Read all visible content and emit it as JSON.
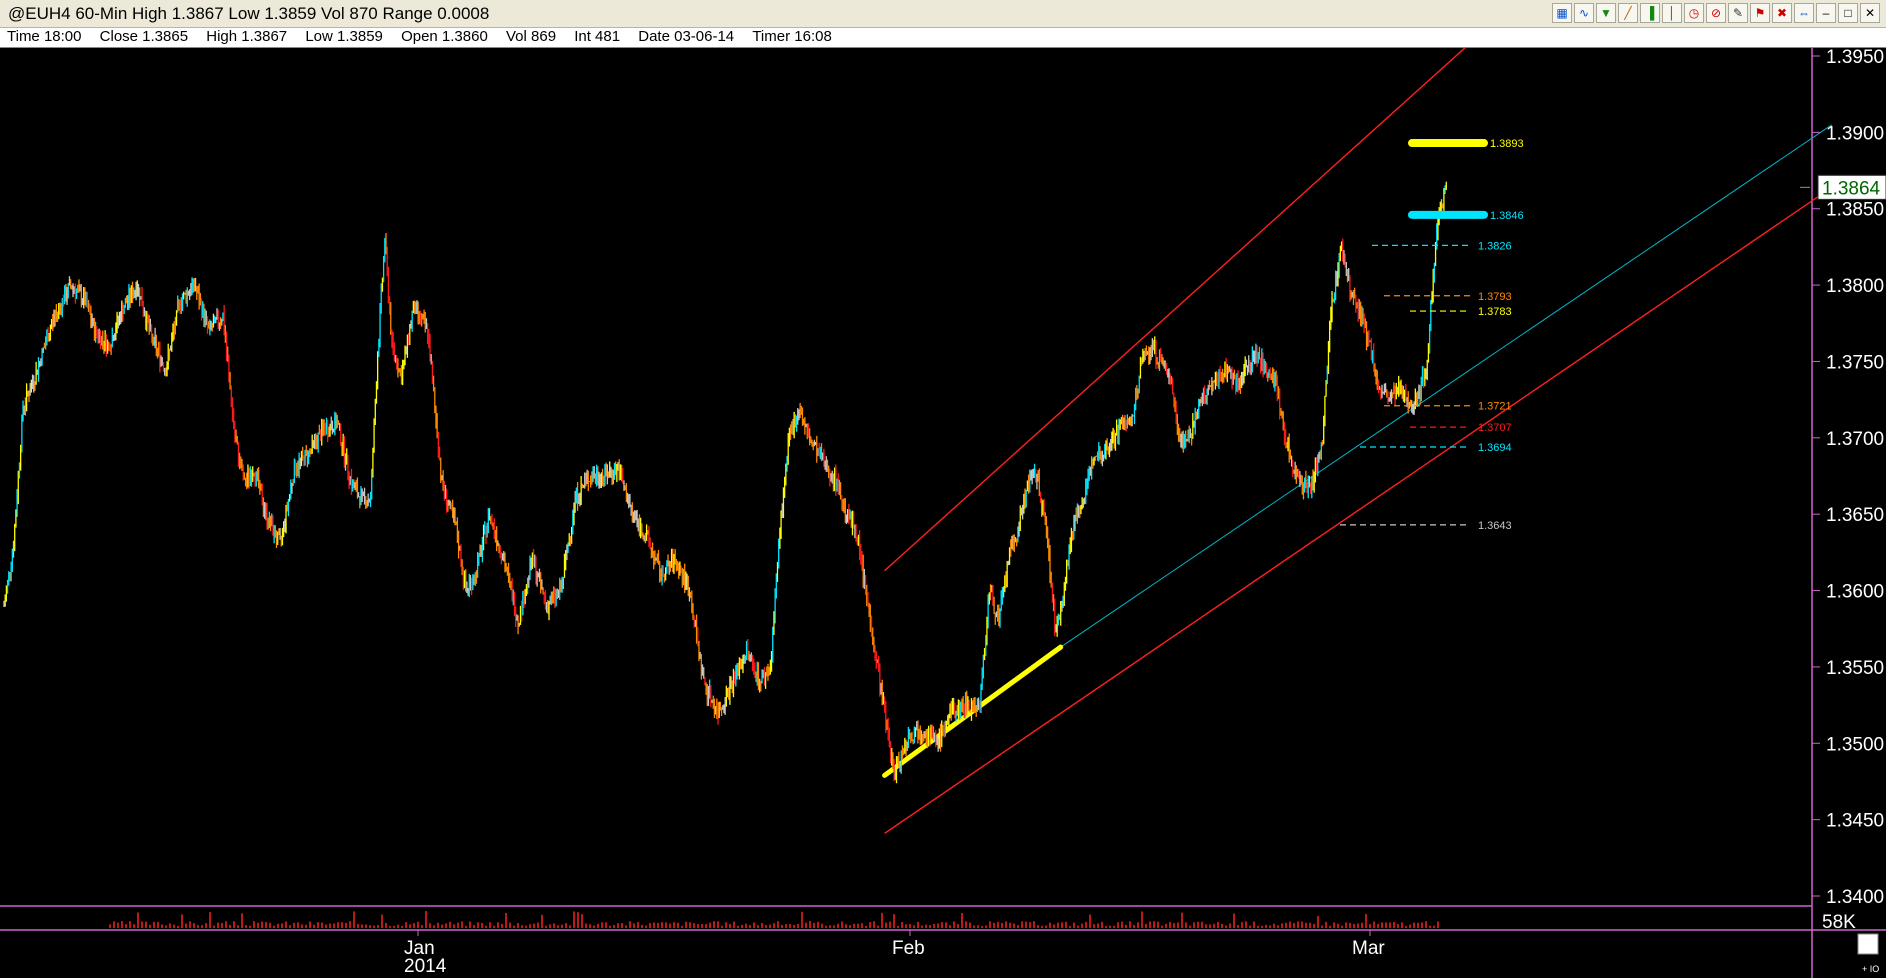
{
  "title": "@EUH4 60-Min High 1.3867 Low 1.3859 Vol 870 Range 0.0008",
  "toolbar_icons": [
    "chart-type-icon",
    "wave-icon",
    "filter-icon",
    "line-draw-icon",
    "bar-chart-icon",
    "candle-icon",
    "clock-icon",
    "no-entry-icon",
    "pencil-icon",
    "flag-icon",
    "delete-icon",
    "scroll-icon",
    "minimize-icon",
    "restore-icon",
    "close-icon"
  ],
  "info": {
    "time": "Time 18:00",
    "close": "Close 1.3865",
    "high": "High 1.3867",
    "low": "Low 1.3859",
    "open": "Open 1.3860",
    "vol": "Vol 869",
    "int": "Int 481",
    "date": "Date 03-06-14",
    "timer": "Timer 16:08"
  },
  "colors": {
    "background": "#000000",
    "axis": "#cc66cc",
    "channel": "#ff2020",
    "midline": "#00b8c8",
    "yellow": "#ffff00",
    "cyan": "#00e5ff",
    "orange": "#ff8a00",
    "red": "#ff1a1a",
    "white": "#c8c8c8",
    "price_label_bg": "#ffffff",
    "price_label_fg": "#006600"
  },
  "chart_data": {
    "type": "line",
    "symbol": "@EUH4",
    "interval": "60-Min",
    "y_axis": {
      "ticks": [
        "1.3950",
        "1.3900",
        "1.3850",
        "1.3800",
        "1.3750",
        "1.3700",
        "1.3650",
        "1.3600",
        "1.3550",
        "1.3500",
        "1.3450",
        "1.3400"
      ],
      "min": 1.34,
      "max": 1.395
    },
    "x_axis": {
      "labels": [
        "Jan",
        "2014",
        "Feb",
        "Mar"
      ]
    },
    "current_price": "1.3864",
    "volume_label": "58K",
    "price_path": [
      [
        0,
        1.359
      ],
      [
        4,
        1.363
      ],
      [
        8,
        1.372
      ],
      [
        14,
        1.3745
      ],
      [
        20,
        1.3775
      ],
      [
        28,
        1.38
      ],
      [
        34,
        1.379
      ],
      [
        38,
        1.377
      ],
      [
        44,
        1.376
      ],
      [
        50,
        1.3785
      ],
      [
        56,
        1.38
      ],
      [
        62,
        1.3765
      ],
      [
        68,
        1.3745
      ],
      [
        74,
        1.379
      ],
      [
        80,
        1.38
      ],
      [
        86,
        1.377
      ],
      [
        92,
        1.378
      ],
      [
        97,
        1.37
      ],
      [
        101,
        1.367
      ],
      [
        105,
        1.368
      ],
      [
        110,
        1.365
      ],
      [
        116,
        1.363
      ],
      [
        122,
        1.368
      ],
      [
        128,
        1.369
      ],
      [
        134,
        1.3705
      ],
      [
        140,
        1.371
      ],
      [
        146,
        1.367
      ],
      [
        150,
        1.366
      ],
      [
        154,
        1.366
      ],
      [
        157,
        1.3755
      ],
      [
        160,
        1.383
      ],
      [
        163,
        1.376
      ],
      [
        167,
        1.374
      ],
      [
        172,
        1.3785
      ],
      [
        178,
        1.377
      ],
      [
        184,
        1.367
      ],
      [
        190,
        1.364
      ],
      [
        194,
        1.36
      ],
      [
        198,
        1.361
      ],
      [
        204,
        1.365
      ],
      [
        210,
        1.362
      ],
      [
        216,
        1.358
      ],
      [
        222,
        1.362
      ],
      [
        228,
        1.359
      ],
      [
        234,
        1.36
      ],
      [
        240,
        1.366
      ],
      [
        246,
        1.3675
      ],
      [
        252,
        1.3675
      ],
      [
        258,
        1.368
      ],
      [
        264,
        1.365
      ],
      [
        270,
        1.3635
      ],
      [
        276,
        1.361
      ],
      [
        282,
        1.362
      ],
      [
        288,
        1.36
      ],
      [
        294,
        1.354
      ],
      [
        300,
        1.352
      ],
      [
        306,
        1.354
      ],
      [
        312,
        1.356
      ],
      [
        318,
        1.354
      ],
      [
        322,
        1.355
      ],
      [
        326,
        1.364
      ],
      [
        330,
        1.37
      ],
      [
        334,
        1.372
      ],
      [
        338,
        1.37
      ],
      [
        342,
        1.369
      ],
      [
        346,
        1.368
      ],
      [
        350,
        1.367
      ],
      [
        354,
        1.365
      ],
      [
        358,
        1.364
      ],
      [
        362,
        1.36
      ],
      [
        366,
        1.356
      ],
      [
        370,
        1.352
      ],
      [
        374,
        1.348
      ],
      [
        380,
        1.3505
      ],
      [
        386,
        1.351
      ],
      [
        392,
        1.35
      ],
      [
        398,
        1.352
      ],
      [
        404,
        1.3525
      ],
      [
        410,
        1.3525
      ],
      [
        414,
        1.36
      ],
      [
        418,
        1.358
      ],
      [
        422,
        1.362
      ],
      [
        426,
        1.364
      ],
      [
        430,
        1.367
      ],
      [
        434,
        1.3675
      ],
      [
        438,
        1.364
      ],
      [
        442,
        1.357
      ],
      [
        446,
        1.361
      ],
      [
        450,
        1.365
      ],
      [
        454,
        1.366
      ],
      [
        458,
        1.369
      ],
      [
        462,
        1.369
      ],
      [
        466,
        1.37
      ],
      [
        470,
        1.371
      ],
      [
        474,
        1.371
      ],
      [
        478,
        1.375
      ],
      [
        482,
        1.376
      ],
      [
        486,
        1.375
      ],
      [
        490,
        1.374
      ],
      [
        494,
        1.37
      ],
      [
        498,
        1.37
      ],
      [
        502,
        1.372
      ],
      [
        506,
        1.373
      ],
      [
        510,
        1.374
      ],
      [
        514,
        1.3745
      ],
      [
        518,
        1.3735
      ],
      [
        522,
        1.3745
      ],
      [
        526,
        1.3755
      ],
      [
        530,
        1.3745
      ],
      [
        534,
        1.374
      ],
      [
        538,
        1.37
      ],
      [
        542,
        1.368
      ],
      [
        546,
        1.367
      ],
      [
        550,
        1.367
      ],
      [
        554,
        1.37
      ],
      [
        558,
        1.379
      ],
      [
        562,
        1.3825
      ],
      [
        566,
        1.3795
      ],
      [
        570,
        1.378
      ],
      [
        574,
        1.376
      ],
      [
        578,
        1.373
      ],
      [
        582,
        1.3725
      ],
      [
        586,
        1.373
      ],
      [
        590,
        1.3725
      ],
      [
        594,
        1.3725
      ],
      [
        598,
        1.375
      ],
      [
        602,
        1.384
      ],
      [
        606,
        1.3866
      ]
    ],
    "trend_channel": {
      "upper": {
        "start": [
          370,
          1.3613
        ],
        "end": [
          620,
          1.3964
        ]
      },
      "middle": {
        "start": [
          444,
          1.3563
        ],
        "end": [
          768,
          1.3905
        ]
      },
      "lower": {
        "start": [
          370,
          1.3441
        ],
        "end": [
          768,
          1.3864
        ]
      }
    },
    "yellow_support": {
      "start": [
        370,
        1.3479
      ],
      "end": [
        444,
        1.3563
      ]
    },
    "levels": [
      {
        "label": "1.3893",
        "value": 1.3893,
        "color": "#ffff00",
        "style": "bar"
      },
      {
        "label": "1.3846",
        "value": 1.3846,
        "color": "#00e5ff",
        "style": "bar"
      },
      {
        "label": "1.3826",
        "value": 1.3826,
        "color": "#00e5ff",
        "style": "dash"
      },
      {
        "label": "1.3793",
        "value": 1.3793,
        "color": "#ff8a00",
        "style": "dash"
      },
      {
        "label": "1.3783",
        "value": 1.3783,
        "color": "#ffff00",
        "style": "dash"
      },
      {
        "label": "1.3721",
        "value": 1.3721,
        "color": "#ff8a00",
        "style": "dash"
      },
      {
        "label": "1.3707",
        "value": 1.3707,
        "color": "#ff1a1a",
        "style": "dash"
      },
      {
        "label": "1.3694",
        "value": 1.3694,
        "color": "#00e5ff",
        "style": "dash"
      },
      {
        "label": "1.3643",
        "value": 1.3643,
        "color": "#c8c8c8",
        "style": "dash"
      }
    ]
  }
}
